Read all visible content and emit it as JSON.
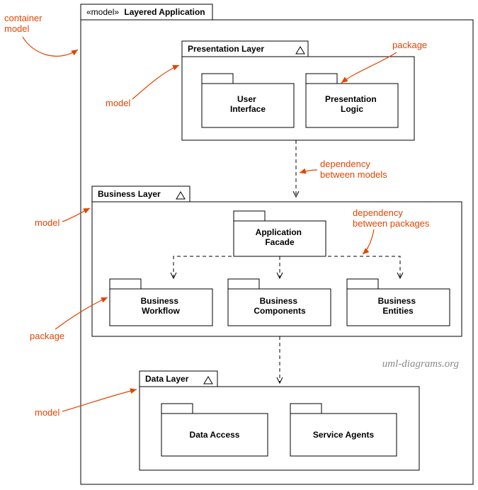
{
  "container": {
    "stereotype": "«model»",
    "name": "Layered Application"
  },
  "layers": {
    "presentation": {
      "name": "Presentation Layer",
      "packages": {
        "ui": "User\nInterface",
        "plogic": "Presentation\nLogic"
      }
    },
    "business": {
      "name": "Business Layer",
      "packages": {
        "facade": "Application\nFacade",
        "workflow": "Business\nWorkflow",
        "components": "Business\nComponents",
        "entities": "Business\nEntities"
      }
    },
    "data": {
      "name": "Data Layer",
      "packages": {
        "access": "Data Access",
        "agents": "Service Agents"
      }
    }
  },
  "annotations": {
    "container_model": "container\nmodel",
    "model1": "model",
    "model2": "model",
    "model3": "model",
    "package1": "package",
    "package2": "package",
    "dep_models": "dependency\nbetween models",
    "dep_packages": "dependency\nbetween packages"
  },
  "watermark": "uml-diagrams.org"
}
